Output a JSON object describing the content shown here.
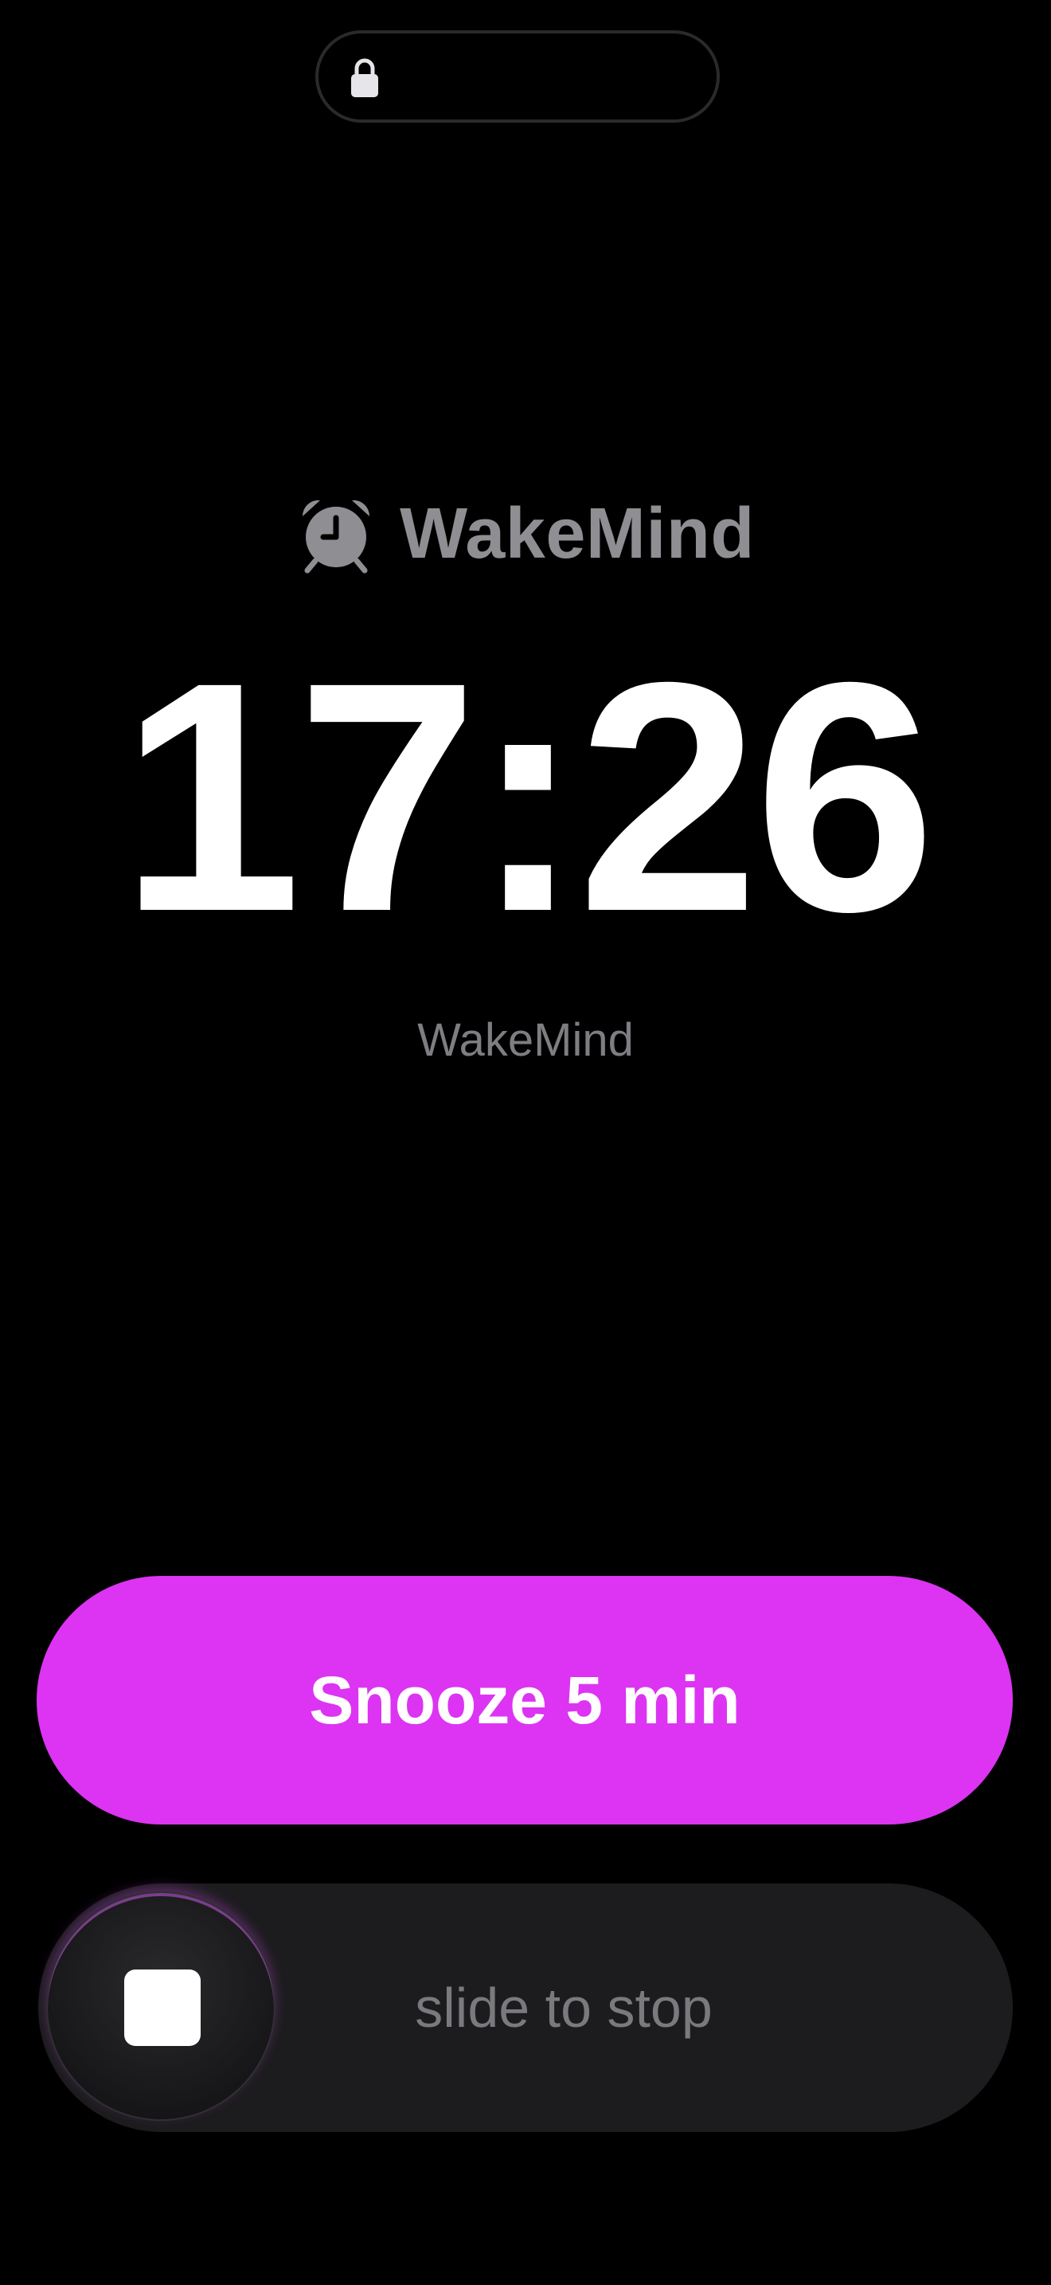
{
  "status": {
    "lock_icon": "lock-icon"
  },
  "header": {
    "app_icon": "alarm-clock-icon",
    "app_name": "WakeMind"
  },
  "alarm": {
    "time": "17:26",
    "label": "WakeMind"
  },
  "actions": {
    "snooze_label": "Snooze 5 min",
    "slide_label": "slide to stop",
    "stop_icon": "stop-icon"
  },
  "colors": {
    "accent": "#dc34f2",
    "background": "#000000",
    "track": "#1c1c1e",
    "secondary_text": "#8e8e93"
  }
}
